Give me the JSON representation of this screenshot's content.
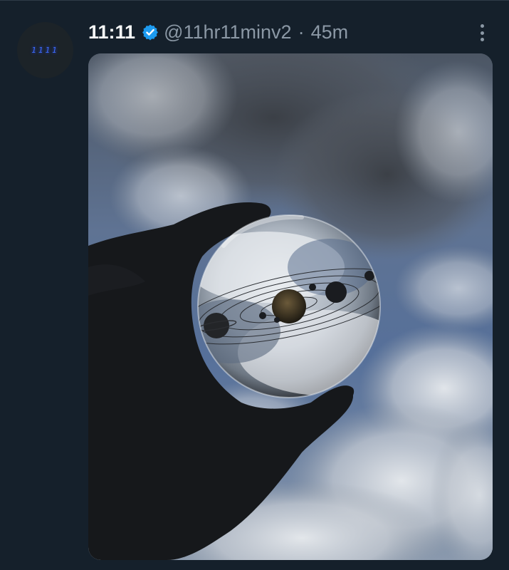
{
  "avatar": {
    "text": "1111"
  },
  "author": {
    "display_name": "11:11",
    "handle": "@11hr11minv2",
    "separator": "·",
    "time": "45m",
    "verified": true
  },
  "icons": {
    "verified": "verified-badge-icon",
    "more": "more-options-icon"
  },
  "colors": {
    "background": "#15202b",
    "verified_blue": "#1d9bf0",
    "secondary_text": "#8b98a5",
    "primary_text": "#f7f9f9"
  }
}
